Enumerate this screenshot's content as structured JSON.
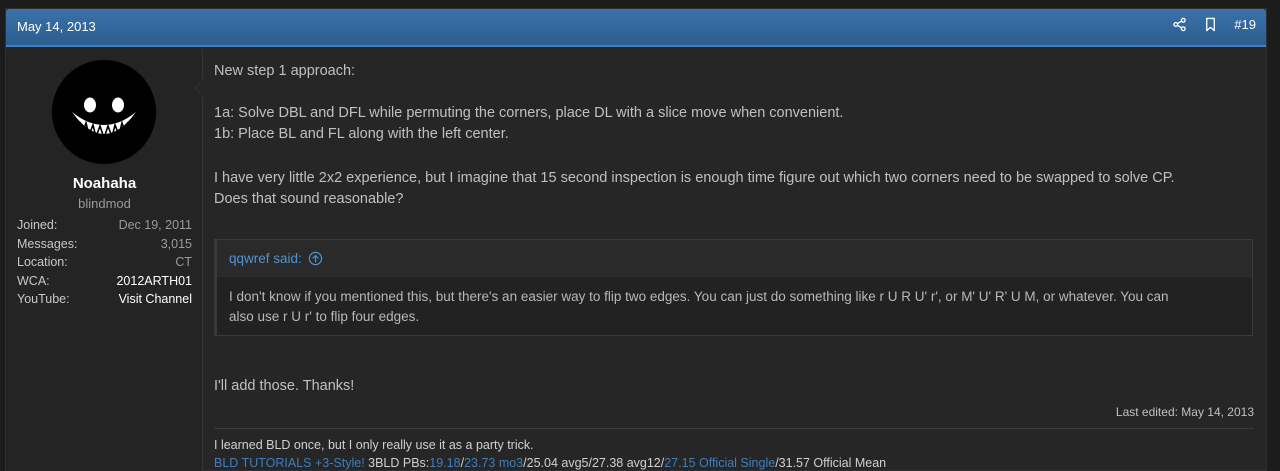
{
  "post": {
    "date": "May 14, 2013",
    "number": "#19",
    "icons": {
      "share": "share-icon",
      "bookmark": "bookmark-icon"
    }
  },
  "user": {
    "name": "Noahaha",
    "title": "blindmod",
    "stats": [
      {
        "label": "Joined:",
        "value": "Dec 19, 2011"
      },
      {
        "label": "Messages:",
        "value": "3,015"
      },
      {
        "label": "Location:",
        "value": "CT"
      },
      {
        "label": "WCA:",
        "value": "2012ARTH01"
      },
      {
        "label": "YouTube:",
        "value": "Visit Channel"
      }
    ]
  },
  "message": {
    "p1": "New step 1 approach:",
    "p2a": "1a: Solve DBL and DFL while permuting the corners, place DL with a slice move when convenient.",
    "p2b": "1b: Place BL and FL along with the left center.",
    "p3a": "I have very little 2x2 experience, but I imagine that 15 second inspection is enough time figure out which two corners need to be swapped to solve CP.",
    "p3b": "Does that sound reasonable?",
    "quote": {
      "author": "qqwref said:",
      "line1": "I don't know if you mentioned this, but there's an easier way to flip two edges. You can just do something like r U R U' r', or M' U' R' U M, or whatever. You can",
      "line2": "also use r U r' to flip four edges."
    },
    "p4": "I'll add those. Thanks!",
    "last_edited": "Last edited: May 14, 2013"
  },
  "signature": {
    "line1": "I learned BLD once, but I only really use it as a party trick.",
    "tutorials": "BLD TUTORIALS",
    "style": "+3-Style!",
    "pbs_label": " 3BLD PBs:",
    "single": "19.18",
    "sep1": "/",
    "mo3": "23.73 mo3",
    "mid": "/25.04 avg5/27.38 avg12/",
    "official_single": "27.15 Official Single",
    "tail": "/31.57 Official Mean"
  },
  "colors": {
    "header": "#2c5d8e",
    "accent": "#3f7ec0",
    "link": "#4f93d2",
    "background": "#262626"
  }
}
